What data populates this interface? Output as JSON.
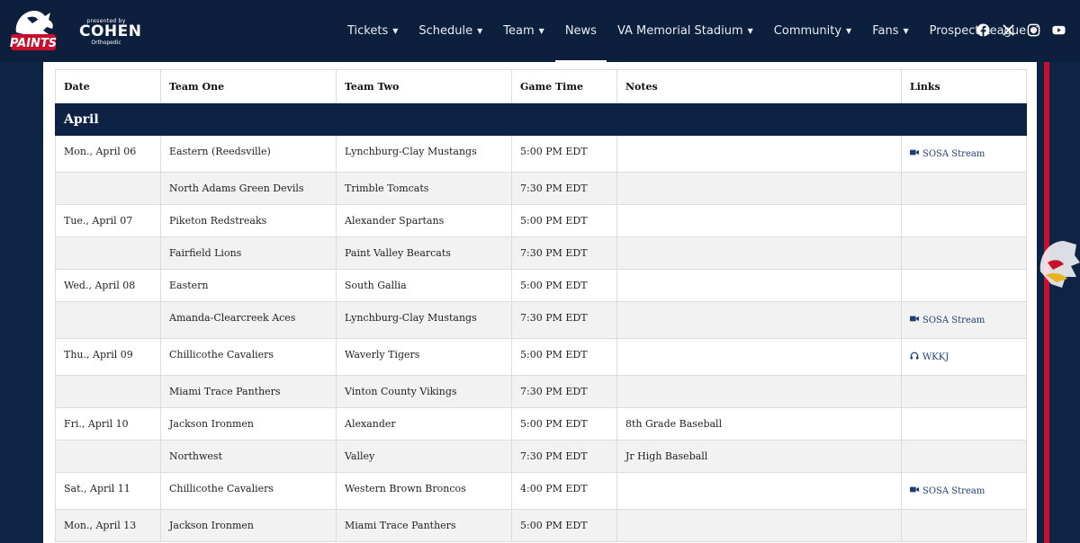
{
  "header": {
    "logo_text": "PAINTS",
    "sponsor": {
      "presented_by": "presented by",
      "name": "COHEN",
      "sub": "Orthopedic"
    },
    "nav": [
      {
        "label": "Tickets",
        "caret": true
      },
      {
        "label": "Schedule",
        "caret": true
      },
      {
        "label": "Team",
        "caret": true
      },
      {
        "label": "News",
        "caret": false,
        "active": true
      },
      {
        "label": "VA Memorial Stadium",
        "caret": true
      },
      {
        "label": "Community",
        "caret": true
      },
      {
        "label": "Fans",
        "caret": true
      },
      {
        "label": "Prospect League",
        "caret": true
      }
    ],
    "socials": [
      "facebook-icon",
      "x-icon",
      "instagram-icon",
      "youtube-icon"
    ]
  },
  "colors": {
    "navy": "#0c1f3d",
    "accent_red": "#c8102e",
    "link": "#1e3e74"
  },
  "table": {
    "columns": [
      "Date",
      "Team One",
      "Team Two",
      "Game Time",
      "Notes",
      "Links"
    ],
    "month": "April",
    "rows": [
      {
        "date": "Mon., April 06",
        "team_one": "Eastern (Reedsville)",
        "team_two": "Lynchburg-Clay Mustangs",
        "time": "5:00 PM EDT",
        "notes": "",
        "link": "SOSA Stream",
        "link_icon": "video-camera-icon"
      },
      {
        "date": "",
        "team_one": "North Adams Green Devils",
        "team_two": "Trimble Tomcats",
        "time": "7:30 PM EDT",
        "notes": "",
        "link": ""
      },
      {
        "date": "Tue., April 07",
        "team_one": "Piketon Redstreaks",
        "team_two": "Alexander Spartans",
        "time": "5:00 PM EDT",
        "notes": "",
        "link": ""
      },
      {
        "date": "",
        "team_one": "Fairfield Lions",
        "team_two": "Paint Valley Bearcats",
        "time": "7:30 PM EDT",
        "notes": "",
        "link": ""
      },
      {
        "date": "Wed., April 08",
        "team_one": "Eastern",
        "team_two": "South Gallia",
        "time": "5:00 PM EDT",
        "notes": "",
        "link": ""
      },
      {
        "date": "",
        "team_one": "Amanda-Clearcreek Aces",
        "team_two": "Lynchburg-Clay Mustangs",
        "time": "7:30 PM EDT",
        "notes": "",
        "link": "SOSA Stream",
        "link_icon": "video-camera-icon"
      },
      {
        "date": "Thu., April 09",
        "team_one": "Chillicothe Cavaliers",
        "team_two": "Waverly Tigers",
        "time": "5:00 PM EDT",
        "notes": "",
        "link": "WKKJ",
        "link_icon": "headphones-icon"
      },
      {
        "date": "",
        "team_one": "Miami Trace Panthers",
        "team_two": "Vinton County Vikings",
        "time": "7:30 PM EDT",
        "notes": "",
        "link": ""
      },
      {
        "date": "Fri., April 10",
        "team_one": "Jackson Ironmen",
        "team_two": "Alexander",
        "time": "5:00 PM EDT",
        "notes": "8th Grade Baseball",
        "link": ""
      },
      {
        "date": "",
        "team_one": "Northwest",
        "team_two": "Valley",
        "time": "7:30 PM EDT",
        "notes": "Jr High Baseball",
        "link": ""
      },
      {
        "date": "Sat., April 11",
        "team_one": "Chillicothe Cavaliers",
        "team_two": "Western Brown Broncos",
        "time": "4:00 PM EDT",
        "notes": "",
        "link": "SOSA Stream",
        "link_icon": "video-camera-icon"
      },
      {
        "date": "Mon., April 13",
        "team_one": "Jackson Ironmen",
        "team_two": "Miami Trace Panthers",
        "time": "5:00 PM EDT",
        "notes": "",
        "link": ""
      }
    ]
  }
}
